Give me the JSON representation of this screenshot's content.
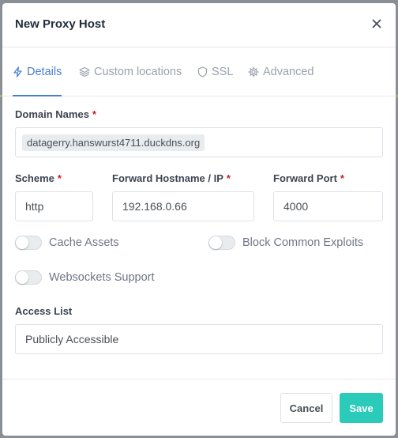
{
  "modal": {
    "title": "New Proxy Host",
    "close_icon": "close-icon"
  },
  "tabs": [
    {
      "label": "Details",
      "icon": "bolt-icon",
      "active": true
    },
    {
      "label": "Custom locations",
      "icon": "layers-icon",
      "active": false
    },
    {
      "label": "SSL",
      "icon": "shield-icon",
      "active": false
    },
    {
      "label": "Advanced",
      "icon": "gear-icon",
      "active": false
    }
  ],
  "form": {
    "domain_names": {
      "label": "Domain Names",
      "required_mark": "*",
      "values": [
        "datagerry.hanswurst4711.duckdns.org"
      ]
    },
    "scheme": {
      "label": "Scheme",
      "required_mark": "*",
      "value": "http"
    },
    "forward_host": {
      "label": "Forward Hostname / IP",
      "required_mark": "*",
      "value": "192.168.0.66"
    },
    "forward_port": {
      "label": "Forward Port",
      "required_mark": "*",
      "value": "4000"
    },
    "toggles": {
      "cache_assets": {
        "label": "Cache Assets",
        "checked": false
      },
      "block_exploits": {
        "label": "Block Common Exploits",
        "checked": false
      },
      "websockets": {
        "label": "Websockets Support",
        "checked": false
      }
    },
    "access_list": {
      "label": "Access List",
      "value": "Publicly Accessible"
    }
  },
  "footer": {
    "cancel_label": "Cancel",
    "save_label": "Save"
  },
  "colors": {
    "accent": "#467fcf",
    "save_button": "#2bcbba",
    "required": "#cd201f"
  }
}
